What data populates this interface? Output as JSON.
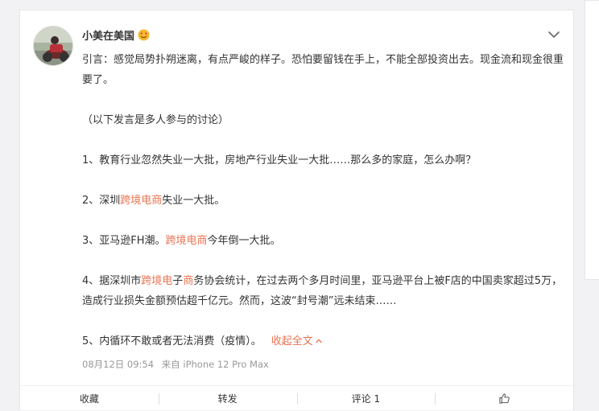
{
  "post": {
    "username": "小美在美国",
    "badge_icon": "heart-eyes-emoji-icon",
    "paragraphs": {
      "p1": "引言：感觉局势扑朔迷离，有点严峻的样子。恐怕要留钱在手上，不能全部投资出去。现金流和现金很重要了。",
      "p2": "（以下发言是多人参与的讨论）",
      "p3": "1、教育行业忽然失业一大批，房地产行业失业一大批……那么多的家庭，怎么办啊？",
      "p4": {
        "before": "2、深圳",
        "link": "跨境电商",
        "after": "失业一大批。"
      },
      "p5": {
        "before": "3、亚马逊FH潮。",
        "link": "跨境电商",
        "after": "今年倒一大批。"
      },
      "p6": {
        "before": "4、据深圳市",
        "link1": "跨境电",
        "mid": "子",
        "link2": "商",
        "after": "务协会统计，在过去两个多月时间里，亚马逊平台上被F店的中国卖家超过5万，造成行业损失金额预估超千亿元。然而，这波“封号潮”远未结束……"
      },
      "p7": "5、内循环不敢或者无法消费（疫情）。",
      "collapse_label": "收起全文"
    },
    "timestamp": "08月12日 09:54",
    "source": "来自 iPhone 12 Pro Max"
  },
  "actions": {
    "favorite": "收藏",
    "repost": "转发",
    "comment": "评论 1",
    "like_icon": "thumbs-up-icon"
  },
  "colors": {
    "link": "#eb7350",
    "meta": "#999999"
  }
}
